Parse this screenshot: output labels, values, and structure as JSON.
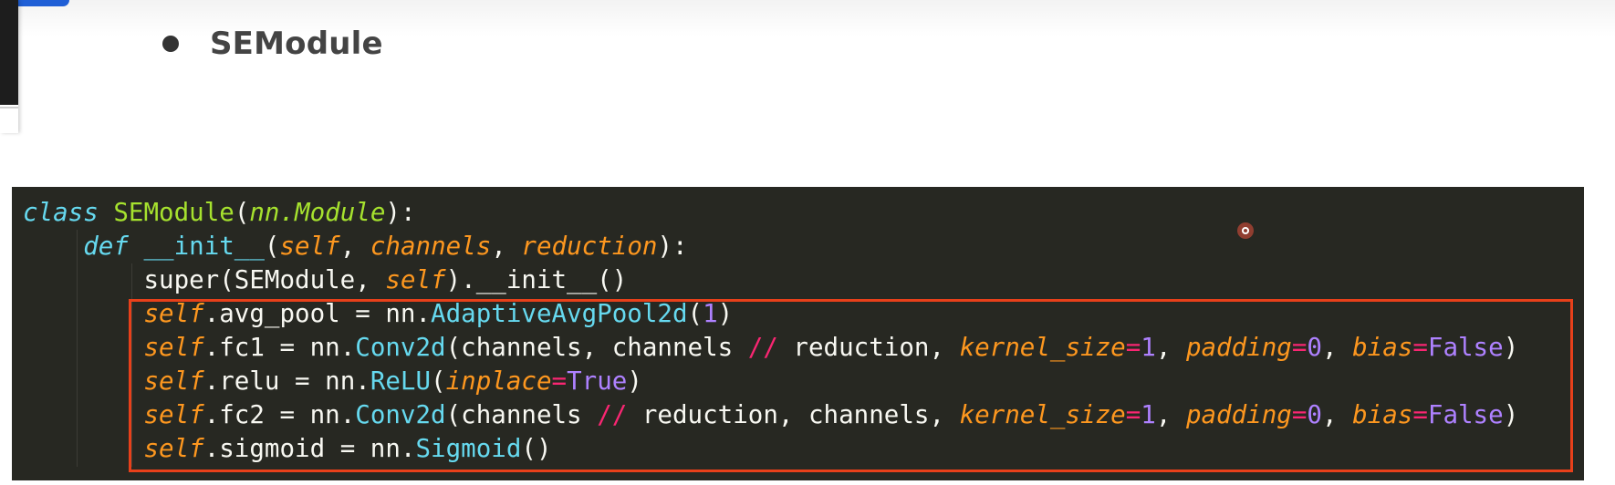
{
  "slide": {
    "heading": "SEModule"
  },
  "code": {
    "line1": {
      "keyword": "class",
      "class_name": "SEModule",
      "paren_open": "(",
      "base": "nn.Module",
      "tail": "):"
    },
    "line2": {
      "keyword": "def",
      "method": "__init__",
      "paren_open": "(",
      "p_self": "self",
      "sep1": ", ",
      "p_channels": "channels",
      "sep2": ", ",
      "p_reduction": "reduction",
      "tail": "):"
    },
    "line3": {
      "a": "super(SEModule, ",
      "self": "self",
      "b": ").__init__()"
    },
    "line4": {
      "self": "self",
      "a": ".avg_pool = nn.",
      "call": "AdaptiveAvgPool2d",
      "paren_open": "(",
      "num": "1",
      "paren_close": ")"
    },
    "line5": {
      "self": "self",
      "a": ".fc1 = nn.",
      "call": "Conv2d",
      "b": "(channels, channels ",
      "op": "//",
      "c": " reduction, ",
      "k1": "kernel_size",
      "eq1": "=",
      "v1": "1",
      "s1": ", ",
      "k2": "padding",
      "eq2": "=",
      "v2": "0",
      "s2": ", ",
      "k3": "bias",
      "eq3": "=",
      "v3": "False",
      "tail": ")"
    },
    "line6": {
      "self": "self",
      "a": ".relu = nn.",
      "call": "ReLU",
      "paren_open": "(",
      "k1": "inplace",
      "eq1": "=",
      "v1": "True",
      "tail": ")"
    },
    "line7": {
      "self": "self",
      "a": ".fc2 = nn.",
      "call": "Conv2d",
      "b": "(channels ",
      "op": "//",
      "c": " reduction, channels, ",
      "k1": "kernel_size",
      "eq1": "=",
      "v1": "1",
      "s1": ", ",
      "k2": "padding",
      "eq2": "=",
      "v2": "0",
      "s2": ", ",
      "k3": "bias",
      "eq3": "=",
      "v3": "False",
      "tail": ")"
    },
    "line8": {
      "self": "self",
      "a": ".sigmoid = nn.",
      "call": "Sigmoid",
      "tail": "()"
    }
  },
  "colors": {
    "code_background": "#272822",
    "highlight_border": "#e8401a",
    "keyword": "#66d9ef",
    "class_name": "#a6e22e",
    "parameter": "#fd971f",
    "number": "#ae81ff",
    "operator": "#f92672"
  }
}
